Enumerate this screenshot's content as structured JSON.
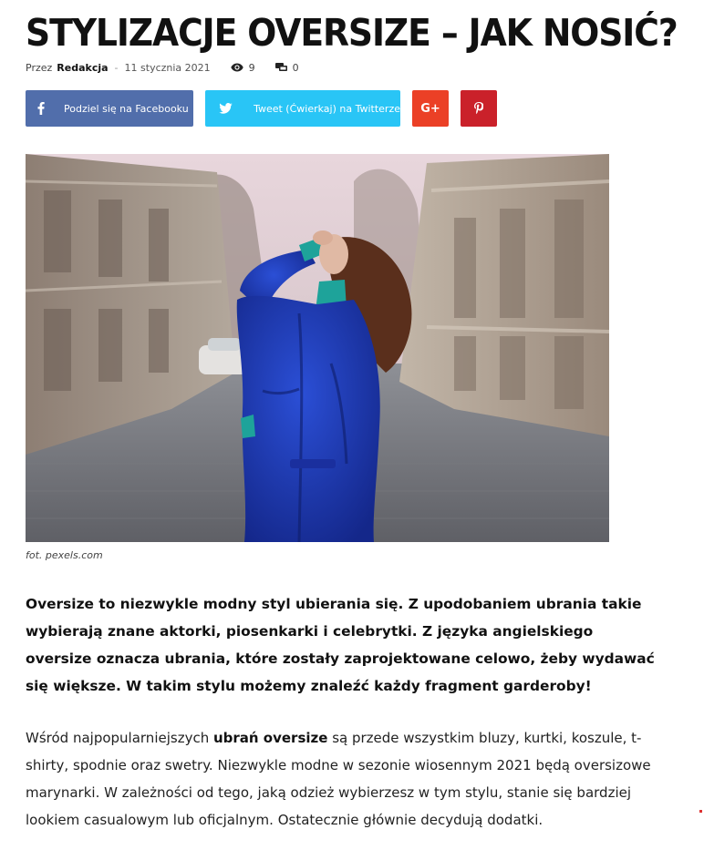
{
  "article": {
    "title": "STYLIZACJE OVERSIZE – JAK NOSIĆ?",
    "meta": {
      "by_label": "Przez",
      "author": "Redakcja",
      "separator": "-",
      "date": "11 stycznia 2021",
      "views": "9",
      "comments": "0"
    },
    "share": {
      "facebook_label": "Podziel się na Facebooku",
      "twitter_label": "Tweet (Ćwierkaj) na Twitterze",
      "googleplus_label": "G+"
    },
    "image_caption": "fot. pexels.com",
    "lead": "Oversize to niezwykle modny styl ubierania się. Z upodobaniem ubrania takie wybierają znane aktorki, piosenkarki i celebrytki. Z języka angielskiego oversize oznacza ubrania, które zostały zaprojektowane celowo, żeby wydawać się większe. W takim stylu możemy znaleźć każdy fragment garderoby!",
    "paragraph": {
      "before": "Wśród najpopularniejszych ",
      "bold": "ubrań oversize",
      "after": " są przede wszystkim bluzy, kurtki, koszule, t-shirty, spodnie oraz swetry. Niezwykle modne w sezonie wiosennym 2021 będą oversizowe marynarki. W zależności od tego, jaką odzież wybierzesz w tym stylu, stanie się bardziej lookiem casualowym lub oficjalnym. Ostatecznie głównie decydują dodatki."
    }
  },
  "colors": {
    "facebook": "#516eab",
    "twitter": "#29c5f6",
    "googleplus": "#eb4026",
    "pinterest": "#ca212a"
  },
  "icons": {
    "views": "eye-icon",
    "comments": "comment-icon",
    "facebook": "facebook-icon",
    "twitter": "twitter-icon",
    "pinterest": "pinterest-icon"
  }
}
